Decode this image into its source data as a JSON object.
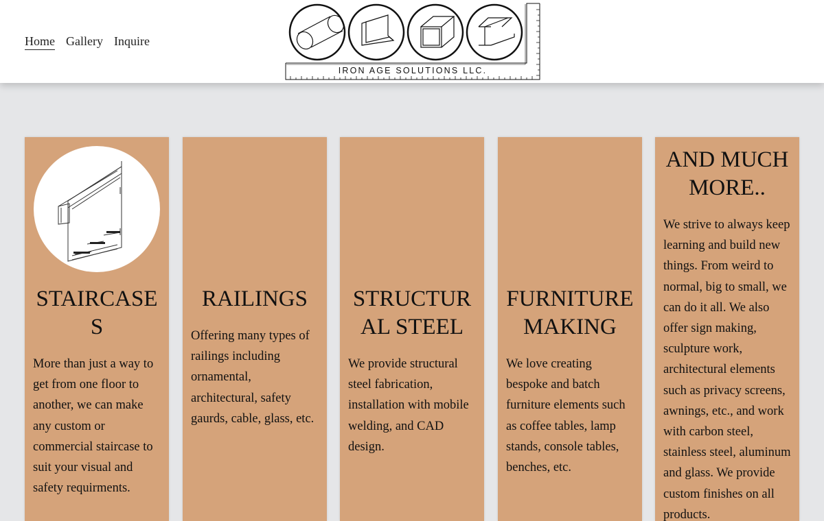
{
  "nav": {
    "items": [
      {
        "label": "Home",
        "active": true
      },
      {
        "label": "Gallery",
        "active": false
      },
      {
        "label": "Inquire",
        "active": false
      }
    ]
  },
  "logo": {
    "text": "IRON AGE SOLUTIONS LLC."
  },
  "cards": [
    {
      "title": "STAIRCASES",
      "text": "More than just a way to get from one floor to another, we can make any custom or commercial staircase to suit your visual and safety requirments."
    },
    {
      "title": "RAILINGS",
      "text": "Offering many types of railings including ornamental, architectural, safety gaurds, cable, glass, etc."
    },
    {
      "title": "STRUCTURAL STEEL",
      "text": "We provide structural steel fabrication, installation with mobile welding, and CAD design."
    },
    {
      "title": "FURNITURE MAKING",
      "text": "We love creating bespoke and batch furniture elements such as coffee tables, lamp stands, console tables, benches, etc."
    },
    {
      "title": "AND MUCH MORE..",
      "text": "We strive to always keep learning and build new things. From weird to normal, big to small, we can do it all. We also offer sign making, sculpture work, architectural elements such as privacy screens, awnings, etc., and work with carbon steel, stainless steel, aluminum and glass. We provide custom finishes on all products."
    }
  ],
  "colors": {
    "page_background": "#e5e6e8",
    "card_background": "#d5a37a",
    "header_background": "#ffffff"
  }
}
